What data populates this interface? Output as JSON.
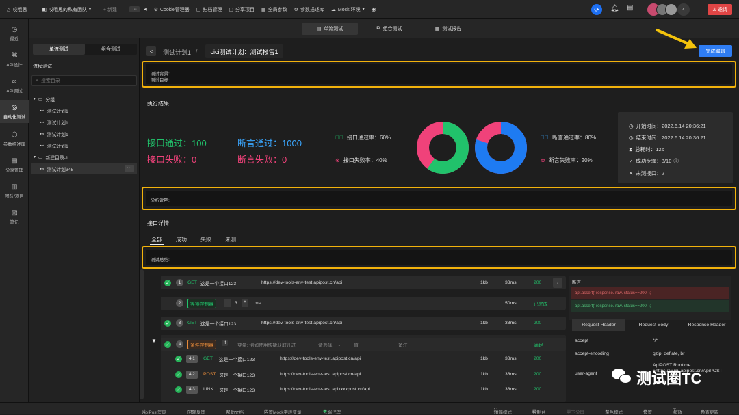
{
  "topbar": {
    "app_name": "哎哦思",
    "team": "哎哦思的私有团队",
    "new_label": "+ 新建",
    "tools": [
      "Cookie管理器",
      "扫档管理",
      "分享项目",
      "全局参数",
      "参数描述库",
      "Mock 环境"
    ],
    "user_count": "4",
    "invite": "邀请",
    "colors": {
      "blue": "#1d6ff2",
      "invite": "#e04545"
    }
  },
  "leftnav": [
    {
      "label": "最近",
      "icon": "clock-icon"
    },
    {
      "label": "API设计",
      "icon": "tree-icon"
    },
    {
      "label": "API调试",
      "icon": "link-icon"
    },
    {
      "label": "自动化测试",
      "icon": "check-circle-icon"
    },
    {
      "label": "参数描述库",
      "icon": "box-icon"
    },
    {
      "label": "分享管理",
      "icon": "share-icon"
    },
    {
      "label": "团队/项目",
      "icon": "team-icon"
    },
    {
      "label": "笔记",
      "icon": "note-icon"
    }
  ],
  "center_tabs": [
    {
      "label": "单流测试",
      "icon": "list-icon"
    },
    {
      "label": "组合测试",
      "icon": "combo-icon"
    },
    {
      "label": "测试报告",
      "icon": "report-icon"
    }
  ],
  "sidebar": {
    "tabs": [
      "单流测试",
      "组合测试"
    ],
    "section_title": "流程测试",
    "search_placeholder": "搜索目录",
    "tree": [
      {
        "label": "分组",
        "level": 0,
        "folder": true
      },
      {
        "label": "测试计划1",
        "level": 1
      },
      {
        "label": "测试计划1",
        "level": 1
      },
      {
        "label": "测试计划1",
        "level": 1
      },
      {
        "label": "测试计划1",
        "level": 1
      },
      {
        "label": "新建目录-1",
        "level": 0,
        "folder": true
      },
      {
        "label": "测试计划345",
        "level": 1,
        "selected": true
      }
    ],
    "more": "···"
  },
  "breadcrumb": {
    "back": "<",
    "parent": "测试计划1",
    "sep": "/",
    "current": "cici测试计划：测试报告1"
  },
  "finish_button": "完成编辑",
  "background": {
    "line1": "测试背景:",
    "line2": "测试目标:"
  },
  "exec": {
    "title": "执行结果",
    "api_pass_label": "接口通过：100",
    "api_fail_label": "接口失败：0",
    "assert_pass_label": "断言通过：1000",
    "assert_fail_label": "断言失败：0",
    "api_pass_rate": "接口通过率：60%",
    "api_fail_rate": "接口失败率：40%",
    "assert_pass_rate": "断言通过率：80%",
    "assert_fail_rate": "断言失败率：20%",
    "donut1_pass": 0.6,
    "donut2_pass": 0.8,
    "colors": {
      "green": "#21c26b",
      "pink": "#f0427a",
      "blue": "#1e7bf2",
      "cyan": "#3aa7ff"
    }
  },
  "info": {
    "start": "开始时间：2022.6.14 20:36:21",
    "end": "结束时间：2022.6.14 20:36:21",
    "total": "总耗时：12s",
    "steps": "成功步骤：8/10",
    "untested": "未测接口：2"
  },
  "analysis_label": "分析说明:",
  "detail": {
    "title": "接口详情",
    "filters": [
      "全部",
      "成功",
      "失败",
      "未测"
    ],
    "summary_label": "测试总结:"
  },
  "rows": [
    {
      "n": "1",
      "method": "GET",
      "name": "这是一个接口123",
      "url": "https://dev-tools-env-test.apipost.cn/api",
      "size": "1kb",
      "time": "33ms",
      "code": "200"
    },
    {
      "n": "2",
      "wait": "等待控制器",
      "minus": "-",
      "val": "3",
      "plus": "+",
      "unit": "ms",
      "time": "50ms",
      "status": "已完成"
    },
    {
      "n": "3",
      "method": "GET",
      "name": "这是一个接口123",
      "url": "https://dev-tools-env-test.apipost.cn/api",
      "size": "1kb",
      "time": "33ms",
      "code": "200"
    },
    {
      "n": "4",
      "cond": "条件控制器",
      "if": "if",
      "var": "变量: 例如使用快捷获取开过",
      "pick": "请选择",
      "value": "值",
      "note": "备注",
      "status": "满足"
    }
  ],
  "subrows": [
    {
      "n": "4-1",
      "method": "GET",
      "name": "这是一个接口123",
      "url": "https://dev-tools-env-test.apipost.cn/api",
      "size": "1kb",
      "time": "33ms",
      "code": "200"
    },
    {
      "n": "4-2",
      "method": "POST",
      "name": "这是一个接口123",
      "url": "https://dev-tools-env-test.apipost.cn/api",
      "size": "1kb",
      "time": "33ms",
      "code": "200"
    },
    {
      "n": "4-3",
      "method": "LINK",
      "name": "这是一个接口123",
      "url": "https://dev-tools-env-test.apixxxxpost.cn/api",
      "size": "1kb",
      "time": "33ms",
      "code": "200"
    }
  ],
  "right_panel": {
    "title": "断言",
    "assert_fail": "apt.assert(' response. raw. status==200' );",
    "assert_ok": "apt.assert(' response. raw. status==200' );",
    "tabs": [
      "Request Header",
      "Request Body",
      "Response Header"
    ],
    "headers": [
      {
        "k": "accept",
        "v": "*/*"
      },
      {
        "k": "accept-encoding",
        "v": "gzip, deflate, br"
      },
      {
        "k": "user-agent",
        "v": "ApiPOST Runtime +https://www.apipost.cn/ApiPOST"
      }
    ]
  },
  "watermark": "测试圈TC",
  "statusbar": {
    "left": [
      "ApiPost官网",
      "问题反馈",
      "帮助文档",
      "内置Mock字段变量",
      "云端代理"
    ],
    "right": [
      "精简模式",
      "控制台",
      "上下分屏",
      "深色模式",
      "设置",
      "缩放",
      "检查更新"
    ]
  }
}
